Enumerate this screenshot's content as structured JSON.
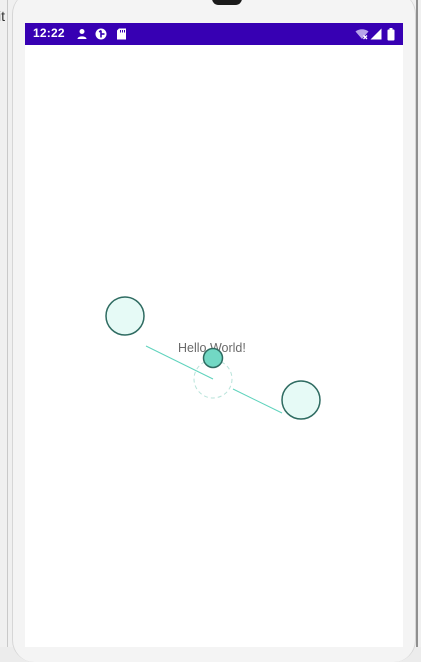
{
  "host": {
    "edge_text": "it"
  },
  "status_bar": {
    "time": "12:22",
    "left_icons": [
      "person-icon",
      "data-saver-icon",
      "sd-card-icon"
    ],
    "right_icons": [
      "wifi-off-icon",
      "cell-signal-icon",
      "battery-icon"
    ],
    "background": "#3700b3"
  },
  "app": {
    "hello_text": "Hello World!",
    "node_fill": "#e6faf6",
    "node_stroke": "#2e6b61",
    "center_fill": "#72d8c4",
    "line_color": "#5fd3bd"
  }
}
